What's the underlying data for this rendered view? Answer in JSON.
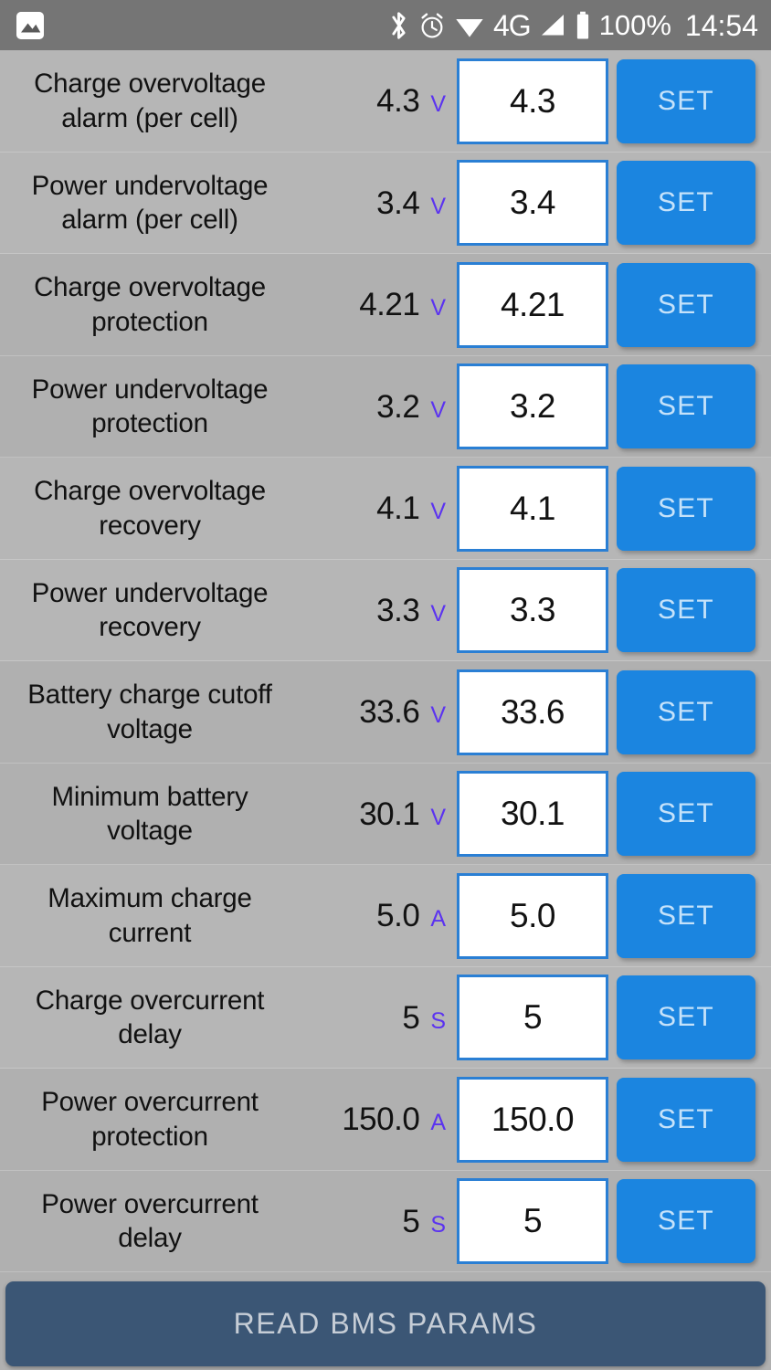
{
  "statusbar": {
    "notification_icon": "photo-icon",
    "icons": [
      "bluetooth-icon",
      "alarm-icon",
      "wifi-icon",
      "signal-icon",
      "battery-icon"
    ],
    "network": "4G",
    "battery_percent": "100%",
    "clock": "14:54"
  },
  "colors": {
    "accent_blue": "#1b85e0",
    "input_border": "#2a7fd4",
    "unit_purple": "#5b33f0",
    "page_bg": "#b0b0b0",
    "statusbar_bg": "#757575",
    "read_button_bg": "#3b5675"
  },
  "set_label": "SET",
  "footer": {
    "read_button_label": "READ BMS PARAMS"
  },
  "rows": [
    {
      "label": "Charge overvoltage alarm (per cell)",
      "value": "4.3",
      "unit": "V",
      "input": "4.3"
    },
    {
      "label": "Power undervoltage alarm (per cell)",
      "value": "3.4",
      "unit": "V",
      "input": "3.4"
    },
    {
      "label": "Charge overvoltage protection",
      "value": "4.21",
      "unit": "V",
      "input": "4.21"
    },
    {
      "label": "Power undervoltage protection",
      "value": "3.2",
      "unit": "V",
      "input": "3.2"
    },
    {
      "label": "Charge overvoltage recovery",
      "value": "4.1",
      "unit": "V",
      "input": "4.1"
    },
    {
      "label": "Power undervoltage recovery",
      "value": "3.3",
      "unit": "V",
      "input": "3.3"
    },
    {
      "label": "Battery charge cutoff voltage",
      "value": "33.6",
      "unit": "V",
      "input": "33.6"
    },
    {
      "label": "Minimum battery voltage",
      "value": "30.1",
      "unit": "V",
      "input": "30.1"
    },
    {
      "label": "Maximum charge current",
      "value": "5.0",
      "unit": "A",
      "input": "5.0"
    },
    {
      "label": "Charge overcurrent delay",
      "value": "5",
      "unit": "S",
      "input": "5"
    },
    {
      "label": "Power overcurrent protection",
      "value": "150.0",
      "unit": "A",
      "input": "150.0"
    },
    {
      "label": "Power overcurrent delay",
      "value": "5",
      "unit": "S",
      "input": "5"
    }
  ]
}
